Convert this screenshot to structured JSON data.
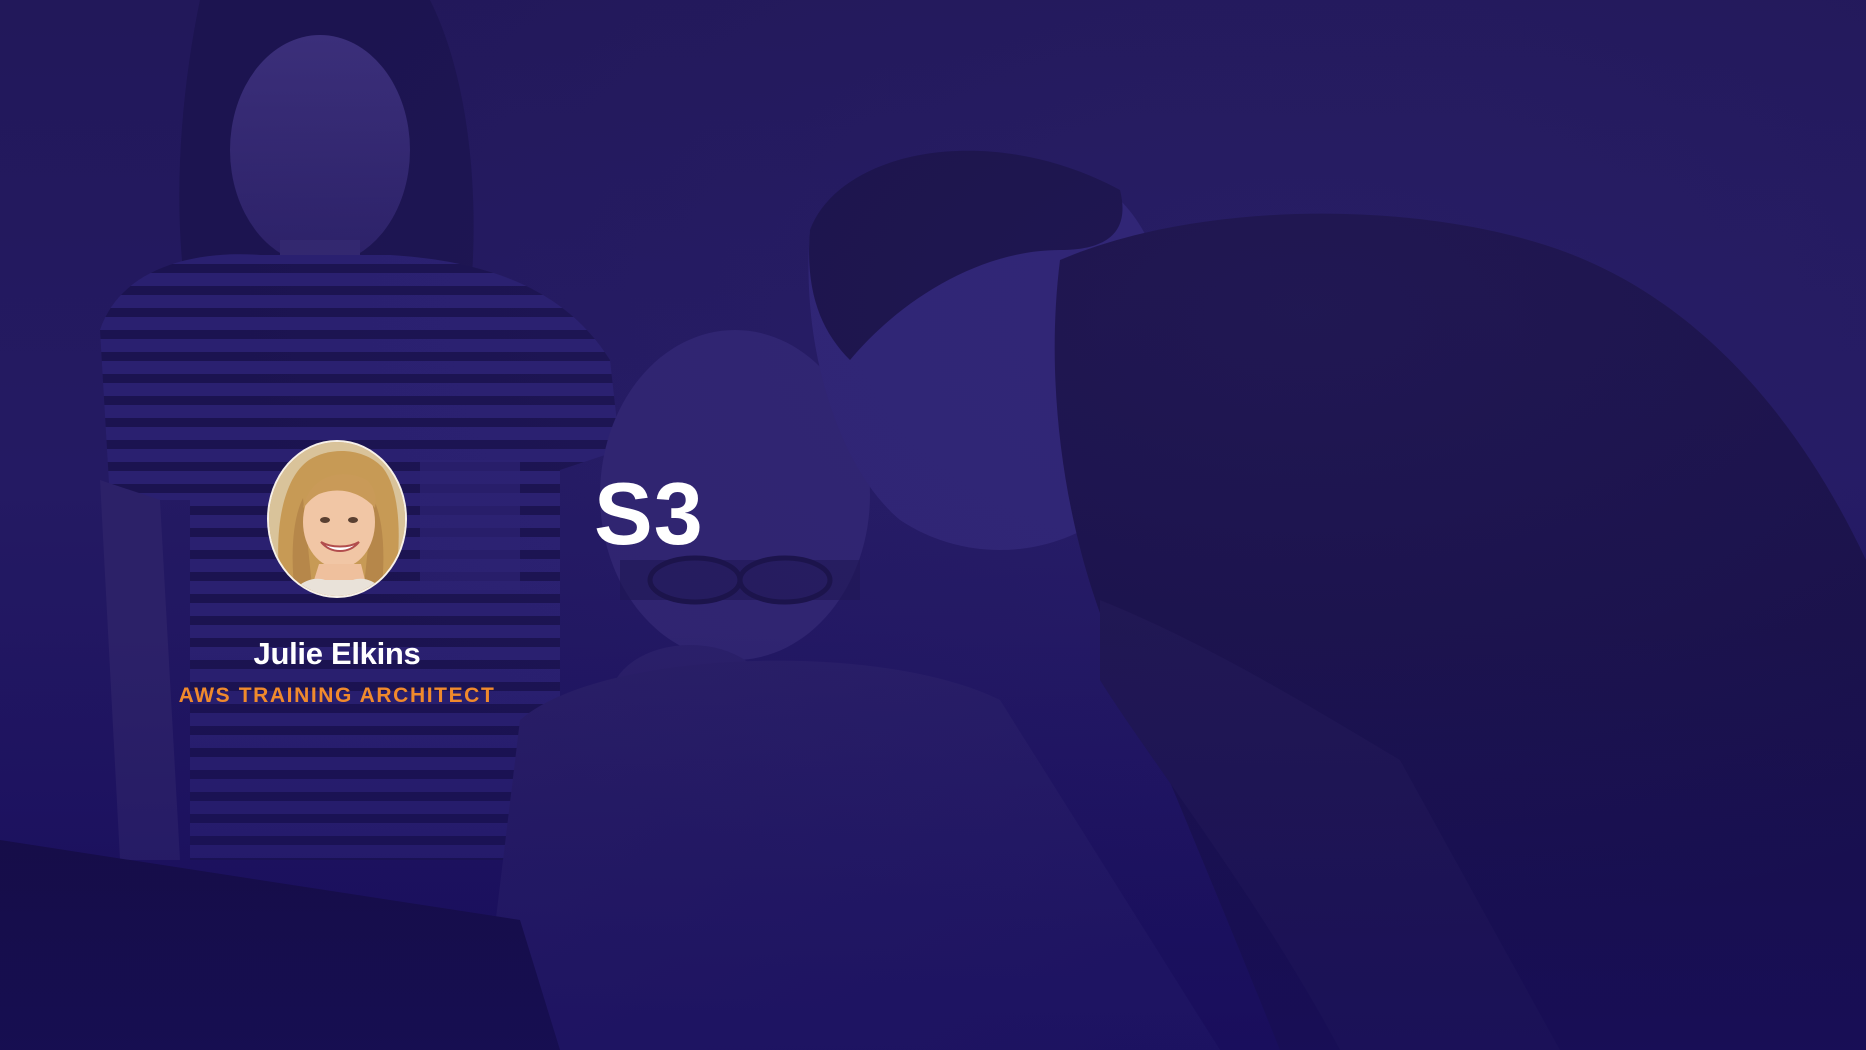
{
  "slide": {
    "title": "S3",
    "presenter": {
      "name": "Julie Elkins",
      "role": "AWS TRAINING ARCHITECT",
      "avatar_icon": "presenter-photo"
    }
  },
  "colors": {
    "background": "#22185a",
    "title_text": "#ffffff",
    "name_text": "#ffffff",
    "role_text": "#f08a2c"
  }
}
